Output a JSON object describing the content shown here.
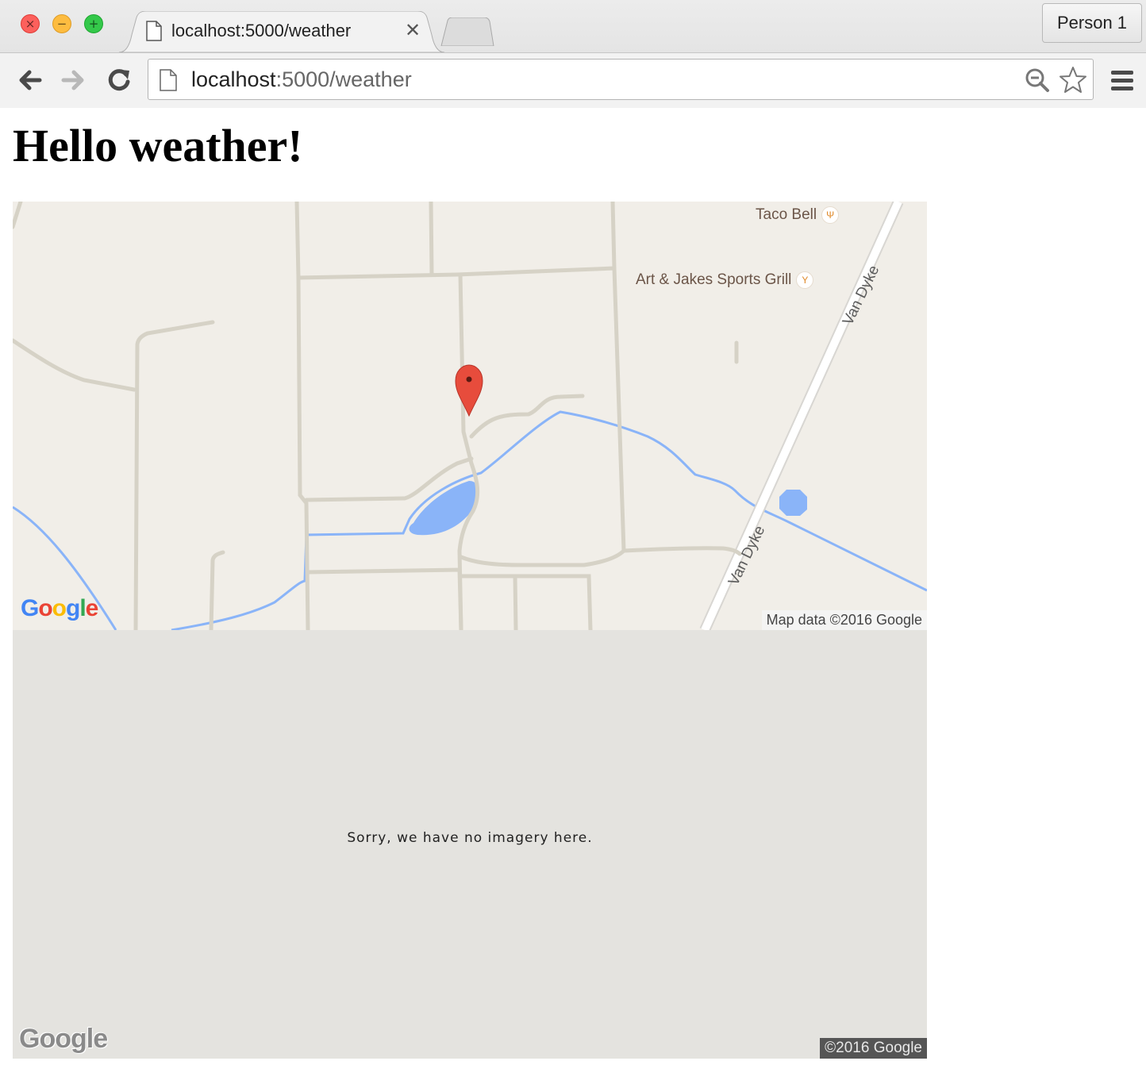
{
  "browser": {
    "tab": {
      "title": "localhost:5000/weather"
    },
    "tab_close": "✕",
    "profile": "Person 1",
    "address": {
      "host": "localhost",
      "rest": ":5000/weather"
    }
  },
  "page": {
    "heading": "Hello weather!"
  },
  "map": {
    "poi": [
      {
        "name": "Taco Bell",
        "icon": "restaurant-icon"
      },
      {
        "name": "Art & Jakes Sports Grill",
        "icon": "bar-icon"
      }
    ],
    "road_labels": [
      "Van Dyke",
      "Van Dyke"
    ],
    "logo": "Google",
    "attribution": "Map data ©2016 Google",
    "colors": {
      "land": "#f1eee8",
      "road": "#d6d2c6",
      "water": "#8ab4f8",
      "marker": "#e74c3c"
    }
  },
  "street_view": {
    "message": "Sorry, we have no imagery here.",
    "logo": "Google",
    "copyright": "©2016 Google"
  }
}
